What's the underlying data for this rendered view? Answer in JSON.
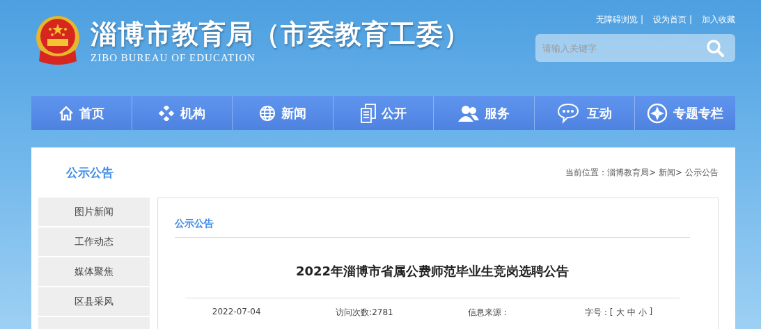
{
  "header": {
    "title": "淄博市教育局（市委教育工委）",
    "subtitle": "ZIBO BUREAU OF EDUCATION",
    "top_links": [
      "无障碍浏览 |",
      "设为首页 |",
      "加入收藏"
    ],
    "search": {
      "placeholder": "请输入关键字"
    }
  },
  "nav": [
    {
      "label": "首页"
    },
    {
      "label": "机构"
    },
    {
      "label": "新闻"
    },
    {
      "label": "公开"
    },
    {
      "label": "服务"
    },
    {
      "label": "互动"
    },
    {
      "label": "专题专栏"
    }
  ],
  "section_title": "公示公告",
  "breadcrumb": "当前位置：淄博教育局> 新闻> 公示公告",
  "sidebar": {
    "items": [
      "图片新闻",
      "工作动态",
      "媒体聚焦",
      "区县采风"
    ]
  },
  "article": {
    "category": "公示公告",
    "title": "2022年淄博市省属公费师范毕业生竞岗选聘公告",
    "date": "2022-07-04",
    "visits": "访问次数:2781",
    "source": "信息来源：",
    "font_size_label": "字号：[",
    "font_sizes": [
      "大",
      "中",
      "小"
    ],
    "font_size_end": "]"
  }
}
